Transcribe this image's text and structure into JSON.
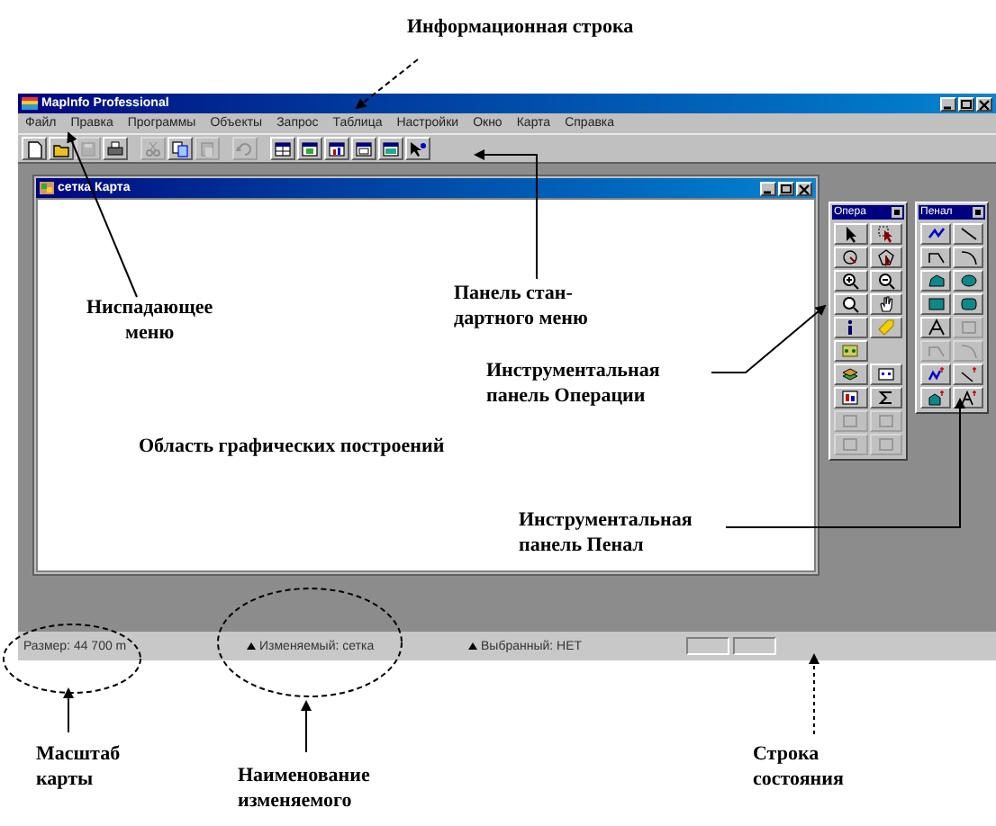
{
  "app_window": {
    "title": "MapInfo Professional",
    "menu": [
      "Файл",
      "Правка",
      "Программы",
      "Объекты",
      "Запрос",
      "Таблица",
      "Настройки",
      "Окно",
      "Карта",
      "Справка"
    ],
    "toolbar": [
      {
        "kind": "new",
        "disabled": false
      },
      {
        "kind": "open",
        "disabled": false
      },
      {
        "kind": "save",
        "disabled": true
      },
      {
        "kind": "print",
        "disabled": false
      },
      {
        "kind": "cut",
        "disabled": true
      },
      {
        "kind": "copy",
        "disabled": false
      },
      {
        "kind": "paste",
        "disabled": true
      },
      {
        "kind": "undo",
        "disabled": true
      },
      {
        "kind": "browser",
        "disabled": false
      },
      {
        "kind": "map",
        "disabled": false
      },
      {
        "kind": "graph",
        "disabled": false
      },
      {
        "kind": "layout",
        "disabled": false
      },
      {
        "kind": "redistrict",
        "disabled": false
      },
      {
        "kind": "help",
        "disabled": false
      }
    ],
    "map_window": {
      "title": "сетка Карта"
    },
    "palettes": [
      {
        "title": "Опера",
        "tools": [
          {
            "kind": "pointer",
            "disabled": false
          },
          {
            "kind": "marquee",
            "disabled": false
          },
          {
            "kind": "radius",
            "disabled": false
          },
          {
            "kind": "polysel",
            "disabled": false
          },
          {
            "kind": "zoomin",
            "disabled": false
          },
          {
            "kind": "zoomout",
            "disabled": false
          },
          {
            "kind": "view",
            "disabled": false
          },
          {
            "kind": "hand",
            "disabled": false
          },
          {
            "kind": "info",
            "disabled": false
          },
          {
            "kind": "label",
            "disabled": false
          },
          {
            "kind": "drag",
            "disabled": false
          },
          {
            "kind": "empty"
          },
          {
            "kind": "layers",
            "disabled": false
          },
          {
            "kind": "legend",
            "disabled": false
          },
          {
            "kind": "stats",
            "disabled": false
          },
          {
            "kind": "sigma",
            "disabled": false
          },
          {
            "kind": "frame",
            "disabled": true
          },
          {
            "kind": "frame",
            "disabled": true
          },
          {
            "kind": "frame",
            "disabled": true
          },
          {
            "kind": "frame",
            "disabled": true
          }
        ]
      },
      {
        "title": "Пенал",
        "tools": [
          {
            "kind": "symbol",
            "disabled": false
          },
          {
            "kind": "line",
            "disabled": false
          },
          {
            "kind": "polyline",
            "disabled": false
          },
          {
            "kind": "arc",
            "disabled": false
          },
          {
            "kind": "polygon",
            "disabled": false
          },
          {
            "kind": "ellipse",
            "disabled": false
          },
          {
            "kind": "rectangle",
            "disabled": false
          },
          {
            "kind": "roundrect",
            "disabled": false
          },
          {
            "kind": "text",
            "disabled": false
          },
          {
            "kind": "frame",
            "disabled": true
          },
          {
            "kind": "polyline",
            "disabled": true
          },
          {
            "kind": "arc",
            "disabled": true
          },
          {
            "kind": "symbolstyle",
            "disabled": false
          },
          {
            "kind": "linestyle",
            "disabled": false
          },
          {
            "kind": "regionstyle",
            "disabled": false
          },
          {
            "kind": "textstyle",
            "disabled": false
          }
        ]
      }
    ],
    "status_bar": [
      "Размер: 44 700 m",
      "Изменяемый: сетка",
      "Выбранный: НЕТ"
    ]
  },
  "annotations": [
    "Информационная строка",
    "Ниспадающее\nменю",
    "Панель стан-\nдартного меню",
    "Инструментальная\nпанель Операции",
    "Область графических построений",
    "Инструментальная\nпанель Пенал",
    "Масштаб\nкарты",
    "Наименование\nизменяемого",
    "Строка\nсостояния"
  ]
}
